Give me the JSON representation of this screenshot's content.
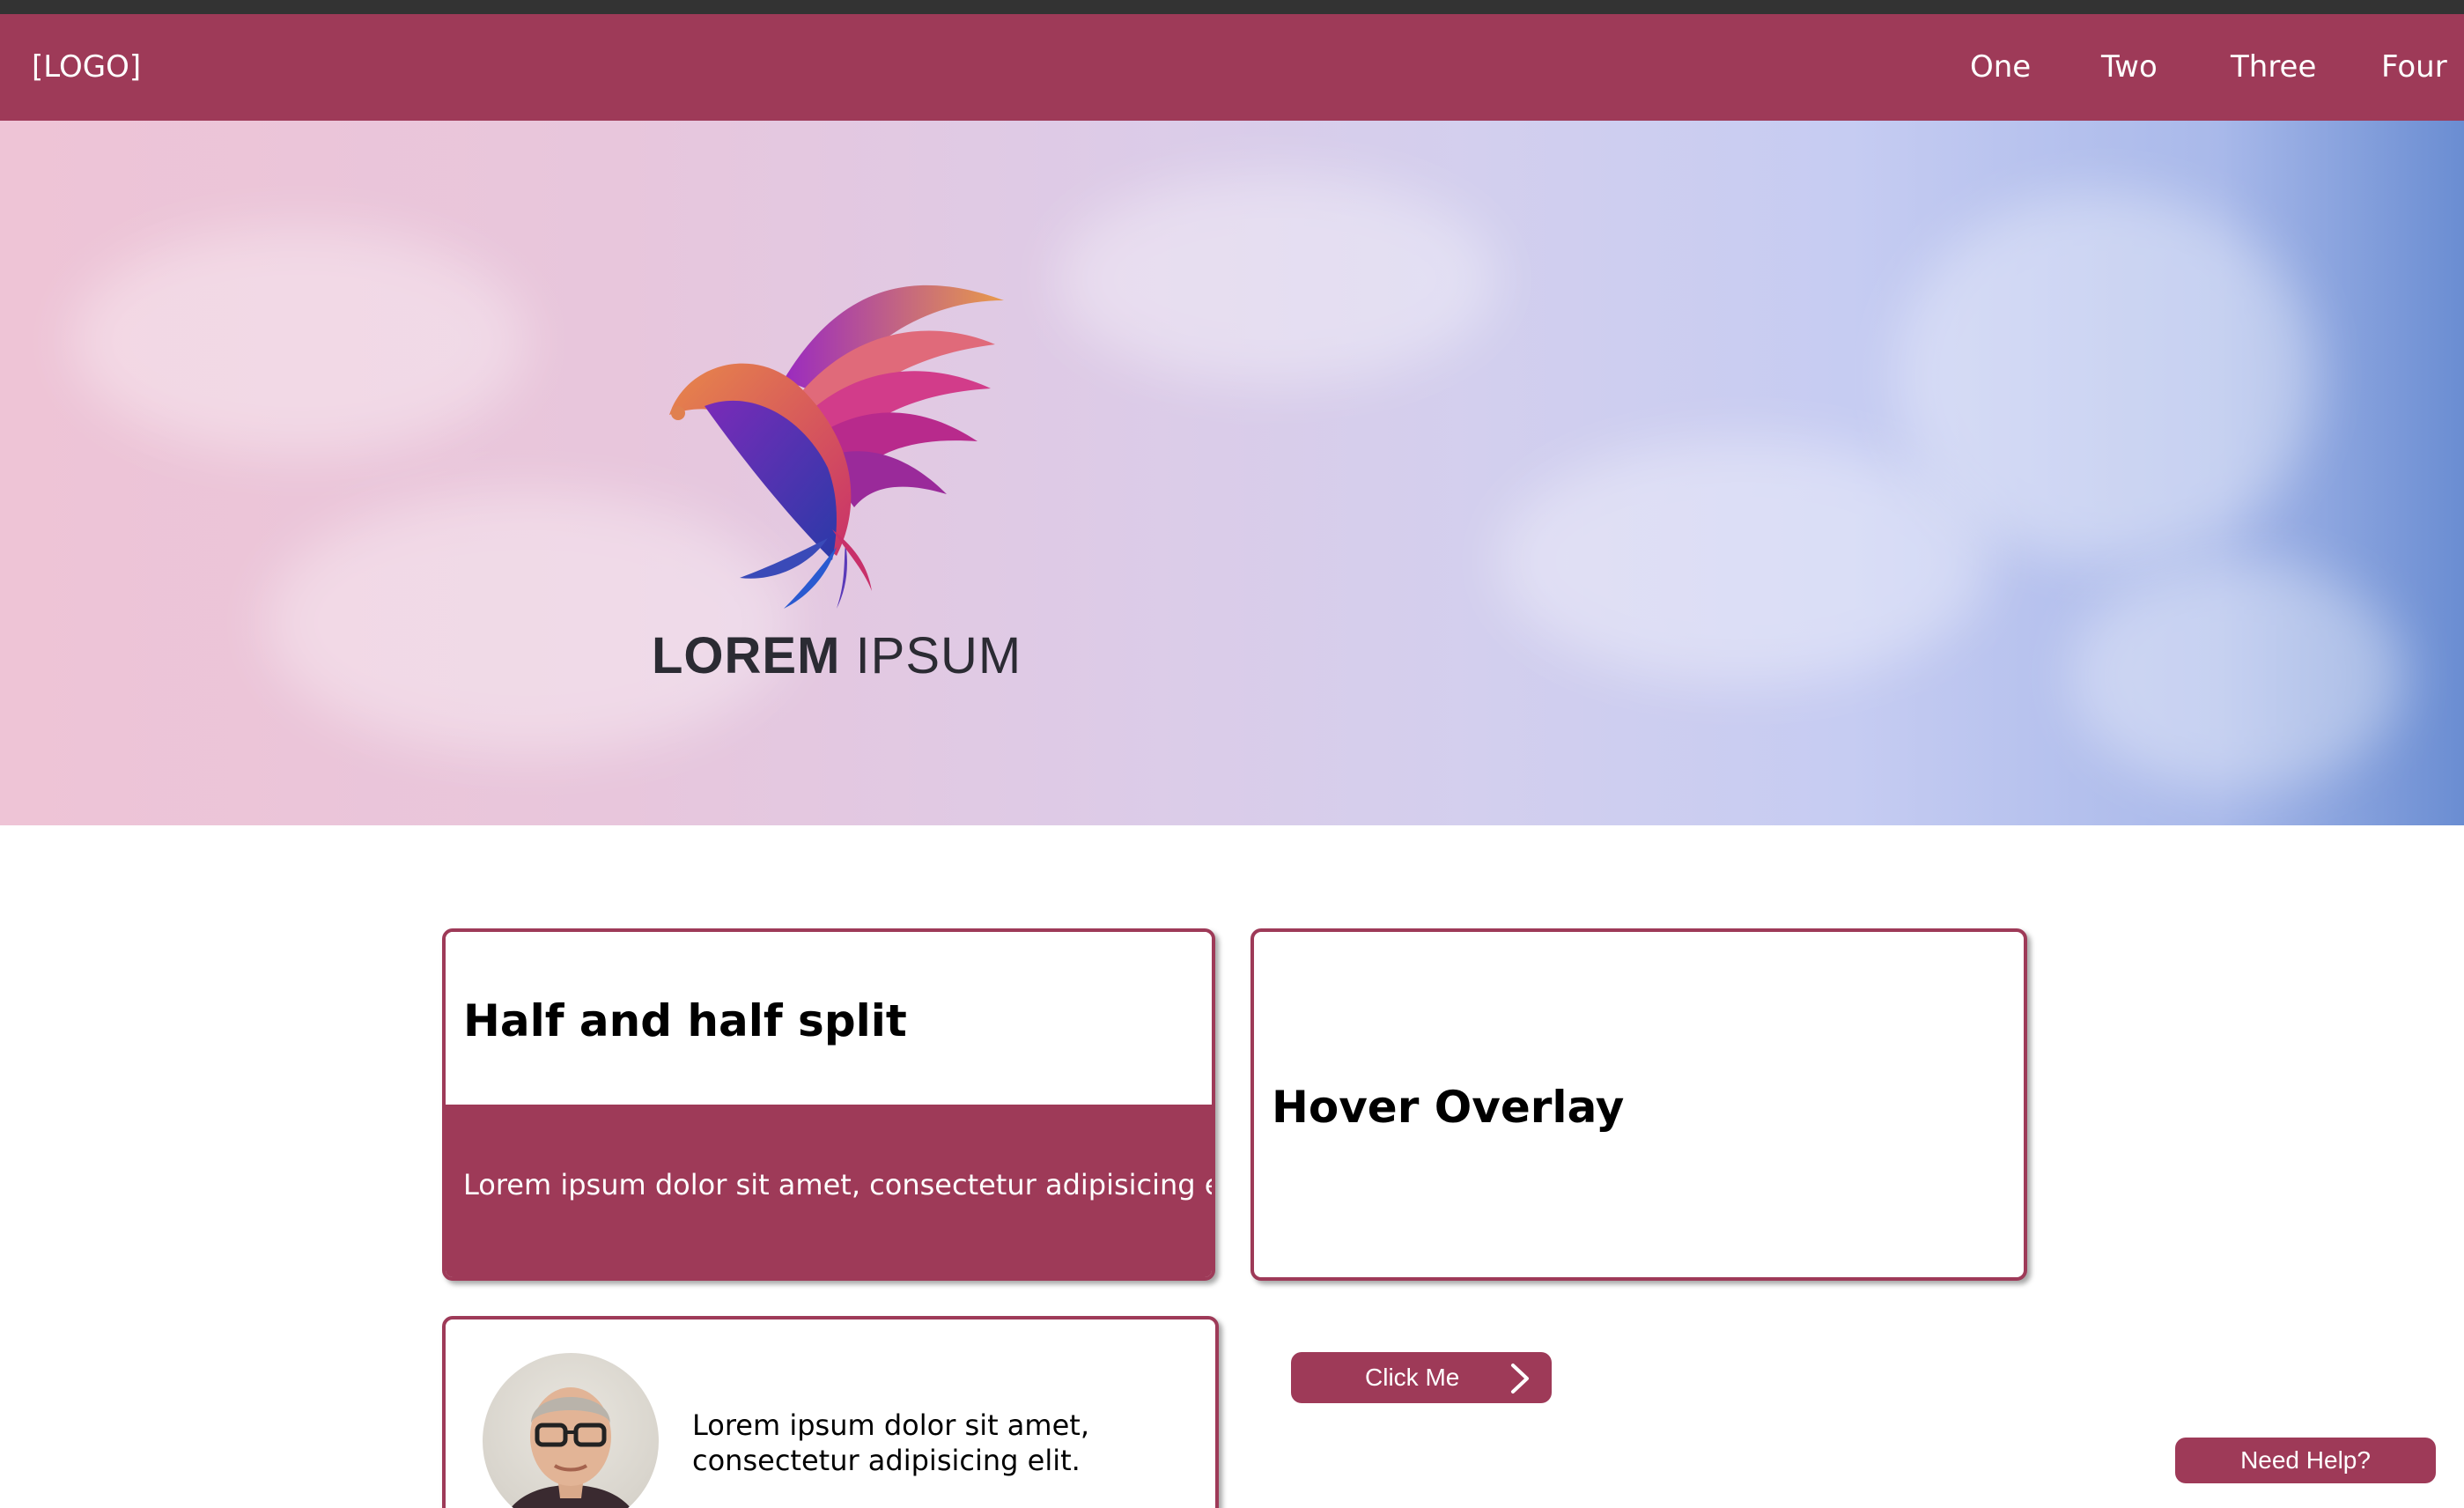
{
  "colors": {
    "brand": "#9e3a58",
    "topstrip": "#333333",
    "white": "#ffffff"
  },
  "navbar": {
    "logo": "[LOGO]",
    "items": [
      {
        "label": "One"
      },
      {
        "label": "Two"
      },
      {
        "label": "Three"
      },
      {
        "label": "Four"
      }
    ]
  },
  "hero": {
    "logo_icon": "bird-icon",
    "brand_bold": "LOREM",
    "brand_light": "IPSUM"
  },
  "cards": {
    "split": {
      "title": "Half and half split",
      "text": "Lorem ipsum dolor sit amet, consectetur adipisicing elit."
    },
    "hover": {
      "title": "Hover Overlay"
    },
    "profile": {
      "text": "Lorem ipsum dolor sit amet, consectetur adipisicing elit."
    }
  },
  "buttons": {
    "click_me": "Click Me",
    "click_icon": "chevron-right-icon",
    "help": "Need Help?"
  }
}
